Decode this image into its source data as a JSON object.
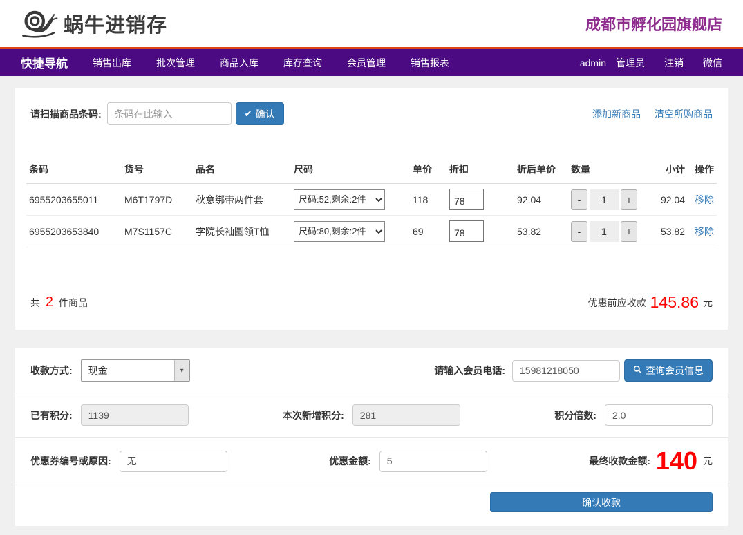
{
  "header": {
    "brand": "蜗牛进销存",
    "store_name": "成都市孵化园旗舰店"
  },
  "nav": {
    "items": [
      "快捷导航",
      "销售出库",
      "批次管理",
      "商品入库",
      "库存查询",
      "会员管理",
      "销售报表"
    ],
    "user": "admin",
    "role": "管理员",
    "logout": "注销",
    "wechat": "微信"
  },
  "scan": {
    "label": "请扫描商品条码:",
    "placeholder": "条码在此输入",
    "confirm_label": "确认",
    "add_product_link": "添加新商品",
    "clear_cart_link": "清空所购商品"
  },
  "table": {
    "headers": [
      "条码",
      "货号",
      "品名",
      "尺码",
      "单价",
      "折扣",
      "折后单价",
      "数量",
      "小计",
      "操作"
    ],
    "minus_label": "-",
    "plus_label": "+",
    "rows": [
      {
        "barcode": "6955203655011",
        "sku": "M6T1797D",
        "name": "秋意绑带两件套",
        "size_option": "尺码:52,剩余:2件",
        "unit_price": "118",
        "discount": "78",
        "discounted_price": "92.04",
        "qty": "1",
        "subtotal": "92.04",
        "remove_label": "移除"
      },
      {
        "barcode": "6955203653840",
        "sku": "M7S1157C",
        "name": "学院长袖圆领T恤",
        "size_option": "尺码:80,剩余:2件",
        "unit_price": "69",
        "discount": "78",
        "discounted_price": "53.82",
        "qty": "1",
        "subtotal": "53.82",
        "remove_label": "移除"
      }
    ]
  },
  "summary": {
    "total_prefix": "共",
    "total_count": "2",
    "total_suffix": "件商品",
    "pre_discount_label": "优惠前应收款",
    "pre_discount_amount": "145.86",
    "currency": "元"
  },
  "payment": {
    "method_label": "收款方式:",
    "method_value": "现金",
    "phone_label": "请输入会员电话:",
    "phone_value": "15981218050",
    "query_member_label": "查询会员信息",
    "existing_points_label": "已有积分:",
    "existing_points_value": "1139",
    "new_points_label": "本次新增积分:",
    "new_points_value": "281",
    "points_multiplier_label": "积分倍数:",
    "points_multiplier_value": "2.0",
    "coupon_label": "优惠券编号或原因:",
    "coupon_value": "无",
    "discount_amount_label": "优惠金额:",
    "discount_amount_value": "5",
    "final_amount_label": "最终收款金额:",
    "final_amount_value": "140",
    "currency": "元",
    "confirm_payment_label": "确认收款"
  },
  "colors": {
    "nav_bg": "#4b0a81",
    "nav_top_border": "#e2441b",
    "accent_blue": "#337ab7",
    "danger_red": "#ff0000",
    "store_name_purple": "#8e2d8e"
  }
}
